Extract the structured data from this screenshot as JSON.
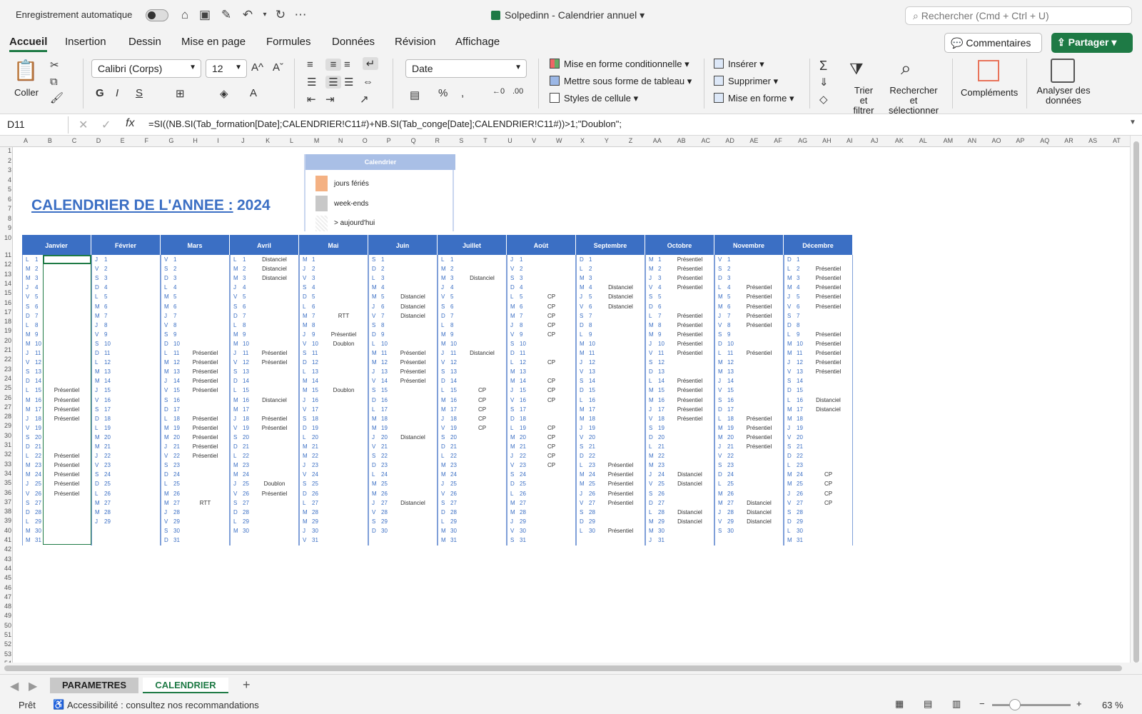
{
  "titlebar": {
    "autosave_label": "Enregistrement automatique",
    "doc_title": "Solpedinn - Calendrier annuel",
    "search_placeholder": "Rechercher (Cmd + Ctrl + U)"
  },
  "tabs": [
    "Accueil",
    "Insertion",
    "Dessin",
    "Mise en page",
    "Formules",
    "Données",
    "Révision",
    "Affichage"
  ],
  "buttons": {
    "comments": "Commentaires",
    "share": "Partager"
  },
  "ribbon": {
    "paste": "Coller",
    "font": "Calibri (Corps)",
    "font_size": "12",
    "number_format": "Date",
    "conditional": "Mise en forme conditionnelle",
    "as_table": "Mettre sous forme de tableau",
    "cell_styles": "Styles de cellule",
    "insert": "Insérer",
    "delete": "Supprimer",
    "format": "Mise en forme",
    "sort": "Trier et filtrer",
    "find": "Rechercher et sélectionner",
    "addins": "Compléments",
    "analyze": "Analyser des données"
  },
  "formula_bar": {
    "cell": "D11",
    "formula": "=SI((NB.SI(Tab_formation[Date];CALENDRIER!C11#)+NB.SI(Tab_conge[Date];CALENDRIER!C11#))>1;\"Doublon\";"
  },
  "columns": [
    "A",
    "B",
    "C",
    "D",
    "E",
    "F",
    "G",
    "H",
    "I",
    "J",
    "K",
    "L",
    "M",
    "N",
    "O",
    "P",
    "Q",
    "R",
    "S",
    "T",
    "U",
    "V",
    "W",
    "X",
    "Y",
    "Z",
    "AA",
    "AB",
    "AC",
    "AD",
    "AE",
    "AF",
    "AG",
    "AH",
    "AI",
    "AJ",
    "AK",
    "AL",
    "AM",
    "AN",
    "AO",
    "AP",
    "AQ",
    "AR",
    "AS",
    "AT"
  ],
  "calendar": {
    "title": "CALENDRIER DE L'ANNEE :",
    "year": "2024",
    "legend_title": "Calendrier",
    "legend": [
      {
        "label": "jours fériés",
        "color": "#f4b183"
      },
      {
        "label": "week-ends",
        "color": "#c8c8c8"
      },
      {
        "label": "> aujourd'hui",
        "color": "#eeeeee"
      }
    ],
    "months": [
      {
        "name": "Janvier",
        "first": 1,
        "days": 31,
        "events": {
          "15": "Présentiel",
          "16": "Présentiel",
          "17": "Présentiel",
          "18": "Présentiel",
          "22": "Présentiel",
          "23": "Présentiel",
          "24": "Présentiel",
          "25": "Présentiel",
          "26": "Présentiel"
        }
      },
      {
        "name": "Février",
        "first": 4,
        "days": 29,
        "events": {}
      },
      {
        "name": "Mars",
        "first": 5,
        "days": 31,
        "events": {
          "11": "Présentiel",
          "12": "Présentiel",
          "13": "Présentiel",
          "14": "Présentiel",
          "15": "Présentiel",
          "18": "Présentiel",
          "19": "Présentiel",
          "20": "Présentiel",
          "21": "Présentiel",
          "22": "Présentiel",
          "27": "RTT"
        }
      },
      {
        "name": "Avril",
        "first": 1,
        "days": 30,
        "events": {
          "1": "Distanciel",
          "2": "Distanciel",
          "3": "Distanciel",
          "11": "Présentiel",
          "12": "Présentiel",
          "16": "Distanciel",
          "18": "Présentiel",
          "19": "Présentiel",
          "25": "Doublon",
          "26": "Présentiel"
        }
      },
      {
        "name": "Mai",
        "first": 3,
        "days": 31,
        "events": {
          "7": "RTT",
          "9": "Présentiel",
          "10": "Doublon",
          "15": "Doublon"
        }
      },
      {
        "name": "Juin",
        "first": 6,
        "days": 30,
        "events": {
          "5": "Distanciel",
          "6": "Distanciel",
          "7": "Distanciel",
          "11": "Présentiel",
          "12": "Présentiel",
          "13": "Présentiel",
          "14": "Présentiel",
          "20": "Distanciel",
          "27": "Distanciel"
        }
      },
      {
        "name": "Juillet",
        "first": 1,
        "days": 31,
        "events": {
          "3": "Distanciel",
          "11": "Distanciel",
          "15": "CP",
          "16": "CP",
          "17": "CP",
          "18": "CP",
          "19": "CP"
        }
      },
      {
        "name": "Août",
        "first": 4,
        "days": 31,
        "events": {
          "5": "CP",
          "6": "CP",
          "7": "CP",
          "8": "CP",
          "9": "CP",
          "12": "CP",
          "14": "CP",
          "15": "CP",
          "16": "CP",
          "19": "CP",
          "20": "CP",
          "21": "CP",
          "22": "CP",
          "23": "CP"
        }
      },
      {
        "name": "Septembre",
        "first": 0,
        "days": 30,
        "events": {
          "4": "Distanciel",
          "5": "Distanciel",
          "6": "Distanciel",
          "23": "Présentiel",
          "24": "Présentiel",
          "25": "Présentiel",
          "26": "Présentiel",
          "27": "Présentiel",
          "30": "Présentiel"
        }
      },
      {
        "name": "Octobre",
        "first": 2,
        "days": 31,
        "events": {
          "1": "Présentiel",
          "2": "Présentiel",
          "3": "Présentiel",
          "4": "Présentiel",
          "7": "Présentiel",
          "8": "Présentiel",
          "9": "Présentiel",
          "10": "Présentiel",
          "11": "Présentiel",
          "14": "Présentiel",
          "15": "Présentiel",
          "16": "Présentiel",
          "17": "Présentiel",
          "18": "Présentiel",
          "24": "Distanciel",
          "25": "Distanciel",
          "28": "Distanciel",
          "29": "Distanciel"
        }
      },
      {
        "name": "Novembre",
        "first": 5,
        "days": 30,
        "events": {
          "4": "Présentiel",
          "5": "Présentiel",
          "6": "Présentiel",
          "7": "Présentiel",
          "8": "Présentiel",
          "11": "Présentiel",
          "18": "Présentiel",
          "19": "Présentiel",
          "20": "Présentiel",
          "21": "Présentiel",
          "27": "Distanciel",
          "28": "Distanciel",
          "29": "Distanciel"
        }
      },
      {
        "name": "Décembre",
        "first": 0,
        "days": 31,
        "events": {
          "2": "Présentiel",
          "3": "Présentiel",
          "4": "Présentiel",
          "5": "Présentiel",
          "6": "Présentiel",
          "9": "Présentiel",
          "10": "Présentiel",
          "11": "Présentiel",
          "12": "Présentiel",
          "13": "Présentiel",
          "16": "Distanciel",
          "17": "Distanciel",
          "24": "CP",
          "25": "CP",
          "26": "CP",
          "27": "CP"
        }
      }
    ],
    "weekday_letters": [
      "D",
      "L",
      "M",
      "M",
      "J",
      "V",
      "S"
    ]
  },
  "sheet_tabs": [
    "PARAMETRES",
    "CALENDRIER"
  ],
  "status": {
    "ready": "Prêt",
    "accessibility": "Accessibilité : consultez nos recommandations",
    "zoom": "63 %"
  }
}
